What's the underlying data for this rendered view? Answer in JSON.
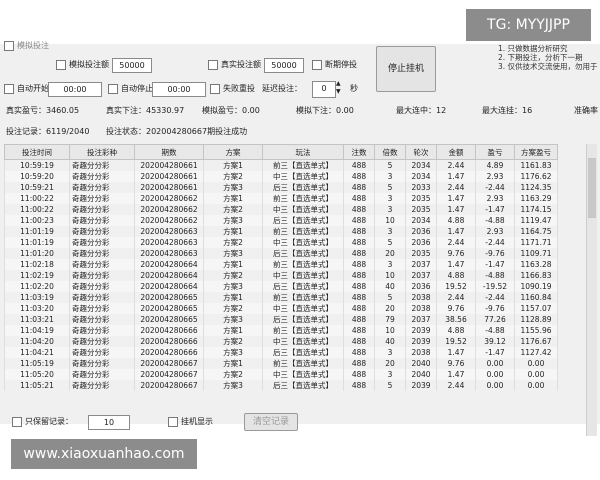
{
  "watermarks": {
    "top_right": "TG: MYYJJPP",
    "bottom_left": "www.xiaoxuanhao.com"
  },
  "controls": {
    "partial_top": "模拟投注",
    "sim_bet_amount_label": "模拟投注额",
    "sim_bet_amount": "50000",
    "real_bet_amount_label": "真实投注额",
    "real_bet_amount": "50000",
    "pause_on_break": "断期停投",
    "stop_button": "停止挂机",
    "auto_start_label": "自动开始",
    "auto_start_time": "00:00",
    "auto_stop_label": "自动停止",
    "auto_stop_time": "00:00",
    "fail_reset_label": "失败重投",
    "delay_label": "延迟投注：",
    "delay_value": "0",
    "delay_unit": "秒"
  },
  "notes": [
    "1. 只做数据分析研究",
    "2. 下期投注，分析下一期",
    "3. 仅供技术交流使用，勿用于"
  ],
  "stats": {
    "real_profit_label": "真实盈亏：",
    "real_profit": "3460.05",
    "real_bet_label": "真实下注：",
    "real_bet": "45330.97",
    "sim_profit_label": "模拟盈亏：",
    "sim_profit": "0.00",
    "sim_bet_label": "模拟下注：",
    "sim_bet": "0.00",
    "max_loss_streak_label": "最大连中：",
    "max_loss_streak": "12",
    "max_win_streak_label": "最大连挂：",
    "max_win_streak": "16",
    "accuracy_label": "准确率"
  },
  "record": {
    "record_label": "投注记录：",
    "record_value": "6119/2040",
    "status_label": "投注状态：",
    "status_value": "202004280667期投注成功"
  },
  "table": {
    "headers": [
      "投注时间",
      "投注彩种",
      "期数",
      "方案",
      "玩法",
      "注数",
      "倍数",
      "轮次",
      "金额",
      "盈亏",
      "方案盈亏"
    ],
    "rows": [
      [
        "10:59:19",
        "奇趣分分彩",
        "202004280661",
        "方案1",
        "前三【直选单式】",
        "488",
        "5",
        "2034",
        "2.44",
        "4.89",
        "1161.83"
      ],
      [
        "10:59:20",
        "奇趣分分彩",
        "202004280661",
        "方案2",
        "中三【直选单式】",
        "488",
        "3",
        "2034",
        "1.47",
        "2.93",
        "1176.62"
      ],
      [
        "10:59:21",
        "奇趣分分彩",
        "202004280661",
        "方案3",
        "后三【直选单式】",
        "488",
        "5",
        "2033",
        "2.44",
        "-2.44",
        "1124.35"
      ],
      [
        "11:00:22",
        "奇趣分分彩",
        "202004280662",
        "方案1",
        "前三【直选单式】",
        "488",
        "3",
        "2035",
        "1.47",
        "2.93",
        "1163.29"
      ],
      [
        "11:00:22",
        "奇趣分分彩",
        "202004280662",
        "方案2",
        "中三【直选单式】",
        "488",
        "3",
        "2035",
        "1.47",
        "-1.47",
        "1174.15"
      ],
      [
        "11:00:23",
        "奇趣分分彩",
        "202004280662",
        "方案3",
        "后三【直选单式】",
        "488",
        "10",
        "2034",
        "4.88",
        "-4.88",
        "1119.47"
      ],
      [
        "11:01:19",
        "奇趣分分彩",
        "202004280663",
        "方案1",
        "前三【直选单式】",
        "488",
        "3",
        "2036",
        "1.47",
        "2.93",
        "1164.75"
      ],
      [
        "11:01:19",
        "奇趣分分彩",
        "202004280663",
        "方案2",
        "中三【直选单式】",
        "488",
        "5",
        "2036",
        "2.44",
        "-2.44",
        "1171.71"
      ],
      [
        "11:01:20",
        "奇趣分分彩",
        "202004280663",
        "方案3",
        "后三【直选单式】",
        "488",
        "20",
        "2035",
        "9.76",
        "-9.76",
        "1109.71"
      ],
      [
        "11:02:18",
        "奇趣分分彩",
        "202004280664",
        "方案1",
        "前三【直选单式】",
        "488",
        "3",
        "2037",
        "1.47",
        "-1.47",
        "1163.28"
      ],
      [
        "11:02:19",
        "奇趣分分彩",
        "202004280664",
        "方案2",
        "中三【直选单式】",
        "488",
        "10",
        "2037",
        "4.88",
        "-4.88",
        "1166.83"
      ],
      [
        "11:02:20",
        "奇趣分分彩",
        "202004280664",
        "方案3",
        "后三【直选单式】",
        "488",
        "40",
        "2036",
        "19.52",
        "-19.52",
        "1090.19"
      ],
      [
        "11:03:19",
        "奇趣分分彩",
        "202004280665",
        "方案1",
        "前三【直选单式】",
        "488",
        "5",
        "2038",
        "2.44",
        "-2.44",
        "1160.84"
      ],
      [
        "11:03:20",
        "奇趣分分彩",
        "202004280665",
        "方案2",
        "中三【直选单式】",
        "488",
        "20",
        "2038",
        "9.76",
        "-9.76",
        "1157.07"
      ],
      [
        "11:03:21",
        "奇趣分分彩",
        "202004280665",
        "方案3",
        "后三【直选单式】",
        "488",
        "79",
        "2037",
        "38.56",
        "77.26",
        "1128.89"
      ],
      [
        "11:04:19",
        "奇趣分分彩",
        "202004280666",
        "方案1",
        "前三【直选单式】",
        "488",
        "10",
        "2039",
        "4.88",
        "-4.88",
        "1155.96"
      ],
      [
        "11:04:20",
        "奇趣分分彩",
        "202004280666",
        "方案2",
        "中三【直选单式】",
        "488",
        "40",
        "2039",
        "19.52",
        "39.12",
        "1176.67"
      ],
      [
        "11:04:21",
        "奇趣分分彩",
        "202004280666",
        "方案3",
        "后三【直选单式】",
        "488",
        "3",
        "2038",
        "1.47",
        "-1.47",
        "1127.42"
      ],
      [
        "11:05:19",
        "奇趣分分彩",
        "202004280667",
        "方案1",
        "前三【直选单式】",
        "488",
        "20",
        "2040",
        "9.76",
        "0.00",
        "0.00"
      ],
      [
        "11:05:20",
        "奇趣分分彩",
        "202004280667",
        "方案2",
        "中三【直选单式】",
        "488",
        "3",
        "2040",
        "1.47",
        "0.00",
        "0.00"
      ],
      [
        "11:05:21",
        "奇趣分分彩",
        "202004280667",
        "方案3",
        "后三【直选单式】",
        "488",
        "5",
        "2039",
        "2.44",
        "0.00",
        "0.00"
      ]
    ]
  },
  "footer": {
    "keep_records_label": "只保留记录：",
    "keep_records_value": "10",
    "display_label": "挂机显示",
    "clear_button": "清空记录"
  }
}
